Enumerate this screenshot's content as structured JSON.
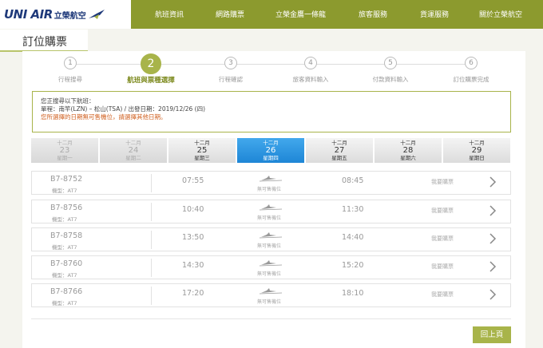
{
  "brand": {
    "logo_text": "UNI AIR",
    "logo_cn": "立榮航空",
    "brand_color": "#1f3a7a",
    "nav_color": "#8c9a2e"
  },
  "nav": [
    "航班資訊",
    "網路購票",
    "立榮金鷹一條龍",
    "旅客服務",
    "貨運服務",
    "關於立榮航空"
  ],
  "page_title": "訂位購票",
  "steps": [
    {
      "num": "1",
      "label": "行程搜尋"
    },
    {
      "num": "2",
      "label": "航班與票種選擇"
    },
    {
      "num": "3",
      "label": "行程確認"
    },
    {
      "num": "4",
      "label": "旅客資料輸入"
    },
    {
      "num": "5",
      "label": "付款資料輸入"
    },
    {
      "num": "6",
      "label": "訂位購票完成"
    }
  ],
  "active_step": 2,
  "notice": {
    "line1": "您正搜尋以下航班：",
    "line2": "單程：南竿(LZN) – 松山(TSA)  /  出發日期：2019/12/26 (四)",
    "warn": "您所選擇的日期無可售機位，請選擇其他日期。"
  },
  "dates": [
    {
      "month": "十二月",
      "day": "23",
      "week": "星期一",
      "state": "past"
    },
    {
      "month": "十二月",
      "day": "24",
      "week": "星期二",
      "state": "past"
    },
    {
      "month": "十二月",
      "day": "25",
      "week": "星期三",
      "state": "future"
    },
    {
      "month": "十二月",
      "day": "26",
      "week": "星期四",
      "state": "selected"
    },
    {
      "month": "十二月",
      "day": "27",
      "week": "星期五",
      "state": "future"
    },
    {
      "month": "十二月",
      "day": "28",
      "week": "星期六",
      "state": "future"
    },
    {
      "month": "十二月",
      "day": "29",
      "week": "星期日",
      "state": "future"
    }
  ],
  "flights": [
    {
      "no": "B7-8752",
      "model": "機型：AT7",
      "dep": "07:55",
      "arr": "08:45",
      "status": "無可售機位",
      "buy": "我要購票"
    },
    {
      "no": "B7-8756",
      "model": "機型：AT7",
      "dep": "10:40",
      "arr": "11:30",
      "status": "無可售機位",
      "buy": "我要購票"
    },
    {
      "no": "B7-8758",
      "model": "機型：AT7",
      "dep": "13:50",
      "arr": "14:40",
      "status": "無可售機位",
      "buy": "我要購票"
    },
    {
      "no": "B7-8760",
      "model": "機型：AT7",
      "dep": "14:30",
      "arr": "15:20",
      "status": "無可售機位",
      "buy": "我要購票"
    },
    {
      "no": "B7-8766",
      "model": "機型：AT7",
      "dep": "17:20",
      "arr": "18:10",
      "status": "無可售機位",
      "buy": "我要購票"
    }
  ],
  "back_label": "回上頁"
}
